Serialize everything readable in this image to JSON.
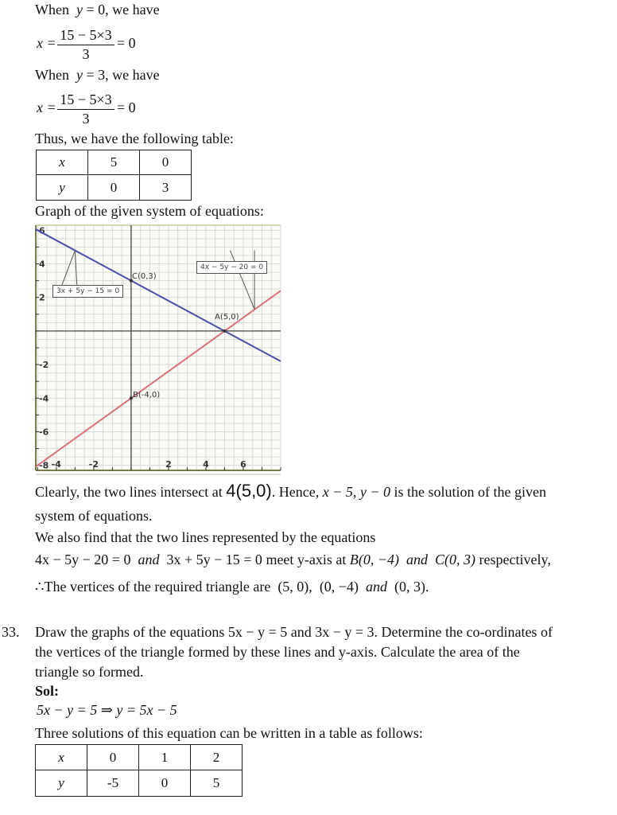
{
  "doc": {
    "line1": {
      "prefix": "When",
      "var": "y",
      "rest": " = 0, we have"
    },
    "frac1": {
      "lhs": "x =",
      "numerator": "15 − 5×3",
      "denominator": "3",
      "rhs": "= 0"
    },
    "line2": {
      "prefix": "When",
      "var": "y",
      "rest": " = 3, we have"
    },
    "frac2": {
      "lhs": "x =",
      "numerator": "15 − 5×3",
      "denominator": "3",
      "rhs": "= 0"
    },
    "thus_text": "Thus, we have the following table:",
    "table1": {
      "rows": [
        {
          "head": "x",
          "cells": [
            "5",
            "0"
          ]
        },
        {
          "head": "y",
          "cells": [
            "0",
            "3"
          ]
        }
      ]
    },
    "graph_caption": "Graph of the given system of equations:",
    "conclusion": {
      "part1": "Clearly, the two lines intersect at",
      "point": "4(5,0)",
      "part2": ". Hence,",
      "solution": "x − 5,  y − 0",
      "part3": "is the solution of the given",
      "line2": "system of equations."
    },
    "also": {
      "line1": "We also find that the two lines represented by the equations",
      "eq1": "4x − 5y − 20 = 0",
      "and1": "and",
      "eq2": "3x + 5y − 15 = 0",
      "meet": "meet y-axis at",
      "b": "B(0, −4)",
      "and2": "and",
      "c": "C(0, 3)",
      "respectively": "respectively,",
      "therefore": "∴",
      "vertices_text": "The vertices of the required triangle are",
      "v1": "(5, 0),",
      "v2": "(0, −4)",
      "and3": "and",
      "v3": "(0, 3)."
    },
    "q33": {
      "number": "33.",
      "line1": "Draw the graphs of the equations 5x − y = 5 and 3x − y = 3. Determine the co-ordinates of",
      "line2": "the vertices of the triangle formed by these lines and y-axis. Calculate the area of the",
      "line3": "triangle so formed.",
      "sol": "Sol:",
      "eq": "5x − y = 5 ⇒ y = 5x − 5",
      "three": "Three solutions of this equation can be written in a table as follows:"
    },
    "table2": {
      "rows": [
        {
          "head": "x",
          "cells": [
            "0",
            "1",
            "2"
          ]
        },
        {
          "head": "y",
          "cells": [
            "-5",
            "0",
            "5"
          ]
        }
      ]
    }
  },
  "chart_data": {
    "type": "line",
    "title": "",
    "xlabel": "",
    "ylabel": "",
    "xlim": [
      -5.1,
      8
    ],
    "ylim": [
      -8.3,
      6.3
    ],
    "grid": true,
    "x_ticks": [
      -4,
      -2,
      2,
      4,
      6
    ],
    "y_ticks": [
      6,
      4,
      2,
      -2,
      -4,
      -6,
      -8
    ],
    "series": [
      {
        "name": "3x + 5y − 15 = 0",
        "color": "#4a4fa8",
        "slope": -0.6,
        "intercept": 3
      },
      {
        "name": "4x − 5y − 20 = 0",
        "color": "#d9737a",
        "slope": 0.8,
        "intercept": -4
      }
    ],
    "points": [
      {
        "label": "C(0,3)",
        "x": 0,
        "y": 3
      },
      {
        "label": "A(5,0)",
        "x": 5,
        "y": 0
      },
      {
        "label": "B(-4,0)",
        "x": 0,
        "y": -4
      }
    ],
    "annotations": [
      {
        "text": "3x + 5y − 15 = 0",
        "anchor_x": -3,
        "anchor_y": 4.8
      },
      {
        "text": "4x − 5y − 20 = 0",
        "anchor_x": 6.6,
        "anchor_y": 1.3
      }
    ]
  }
}
